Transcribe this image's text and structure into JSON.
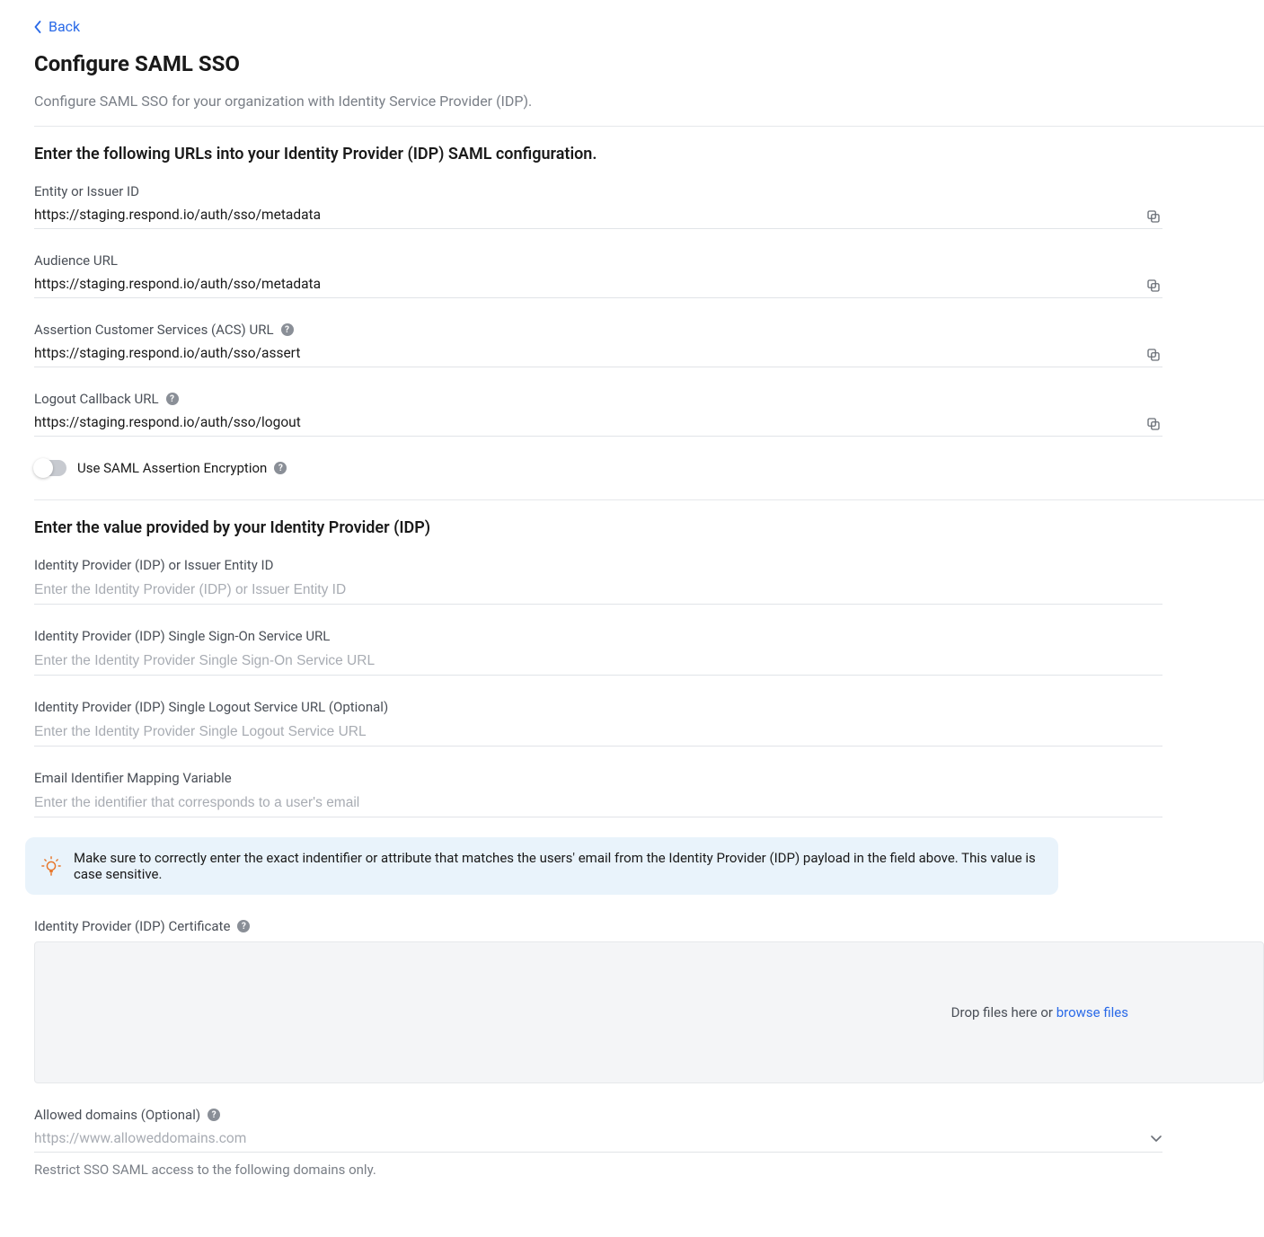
{
  "back_label": "Back",
  "page_title": "Configure SAML SSO",
  "page_subtitle": "Configure SAML SSO for your organization with Identity Service Provider (IDP).",
  "section1_title": "Enter the following URLs into your Identity Provider (IDP) SAML configuration.",
  "entity_id": {
    "label": "Entity or Issuer ID",
    "value": "https://staging.respond.io/auth/sso/metadata"
  },
  "audience_url": {
    "label": "Audience URL",
    "value": "https://staging.respond.io/auth/sso/metadata"
  },
  "acs_url": {
    "label": "Assertion Customer Services (ACS) URL",
    "value": "https://staging.respond.io/auth/sso/assert"
  },
  "logout_url": {
    "label": "Logout Callback URL",
    "value": "https://staging.respond.io/auth/sso/logout"
  },
  "encryption_toggle": {
    "label": "Use SAML Assertion Encryption"
  },
  "section2_title": "Enter the value provided by your Identity Provider (IDP)",
  "idp_entity": {
    "label": "Identity Provider (IDP) or Issuer Entity ID",
    "placeholder": "Enter the Identity Provider (IDP) or Issuer Entity ID"
  },
  "idp_sso": {
    "label": "Identity Provider (IDP) Single Sign-On Service URL",
    "placeholder": "Enter the Identity Provider Single Sign-On Service URL"
  },
  "idp_slo": {
    "label": "Identity Provider (IDP) Single Logout Service URL (Optional)",
    "placeholder": "Enter the Identity Provider Single Logout Service URL"
  },
  "email_map": {
    "label": "Email Identifier Mapping Variable",
    "placeholder": "Enter the identifier that corresponds to a user's email"
  },
  "tip_text": "Make sure to correctly enter the exact indentifier or attribute that matches the users' email from the Identity Provider (IDP) payload in the field above. This value is case sensitive.",
  "cert": {
    "label": "Identity Provider (IDP) Certificate",
    "drop_text": "Drop files here or ",
    "browse_text": "browse files"
  },
  "allowed_domains": {
    "label": "Allowed domains (Optional)",
    "placeholder": "https://www.alloweddomains.com",
    "help": "Restrict SSO SAML access to the following domains only."
  }
}
